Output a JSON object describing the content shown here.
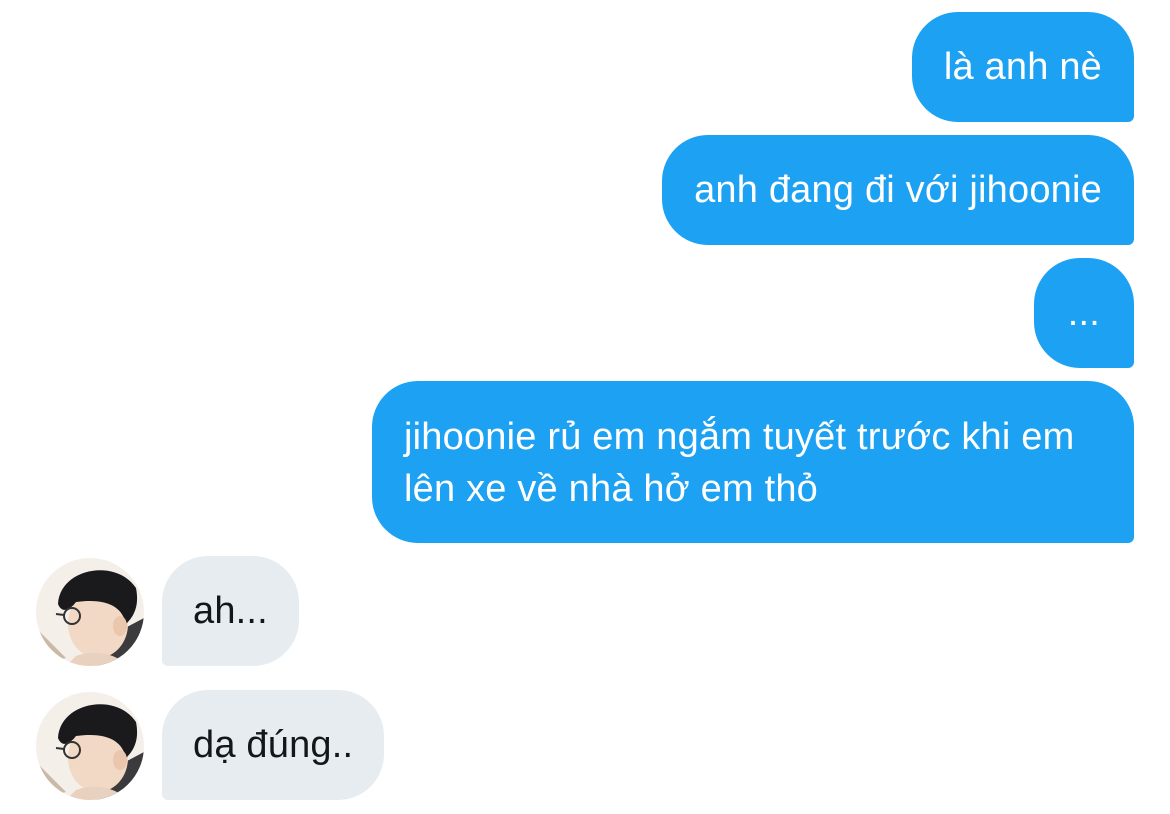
{
  "conversation": {
    "messages": [
      {
        "direction": "outgoing",
        "text": "là anh nè"
      },
      {
        "direction": "outgoing",
        "text": "anh đang đi với jihoonie"
      },
      {
        "direction": "outgoing",
        "text": "..."
      },
      {
        "direction": "outgoing",
        "text": "jihoonie rủ em ngắm tuyết trước khi em lên xe về nhà hở em thỏ"
      },
      {
        "direction": "incoming",
        "text": "ah..."
      },
      {
        "direction": "incoming",
        "text": "dạ đúng.."
      }
    ]
  },
  "colors": {
    "outgoing_bubble": "#1da1f2",
    "incoming_bubble": "#e6ecf0",
    "incoming_text": "#14171a",
    "background": "#ffffff"
  },
  "icons": {
    "avatar": "contact-avatar-photo"
  }
}
